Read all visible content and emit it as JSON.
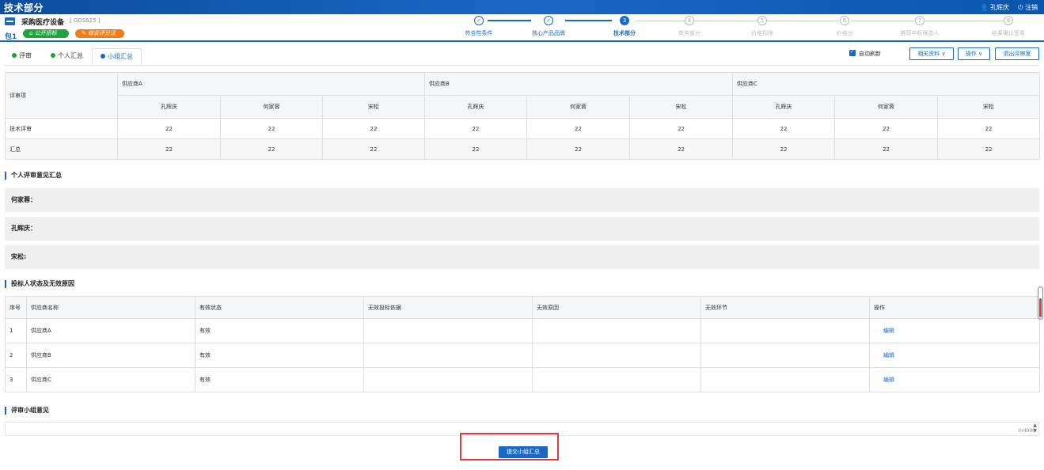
{
  "topbar": {
    "title": "技术部分",
    "user": "孔辉庆",
    "logout": "注销"
  },
  "project": {
    "name": "采购医疗设备",
    "code": "[ GDS525 ]",
    "package": "包1",
    "badge_open": "公开招标",
    "badge_review": "综合评分法"
  },
  "steps": [
    {
      "num": "✓",
      "label": "符合性条件",
      "state": "done"
    },
    {
      "num": "✓",
      "label": "核心产品品牌",
      "state": "done"
    },
    {
      "num": "3",
      "label": "技术部分",
      "state": "cur"
    },
    {
      "num": "4",
      "label": "商务部分",
      "state": "todo"
    },
    {
      "num": "5",
      "label": "价格扣除",
      "state": "todo"
    },
    {
      "num": "6",
      "label": "价格分",
      "state": "todo"
    },
    {
      "num": "7",
      "label": "推荐中标候选人",
      "state": "todo"
    },
    {
      "num": "8",
      "label": "结果确认签章",
      "state": "todo"
    }
  ],
  "tabs": {
    "review": "评审",
    "personal": "个人汇总",
    "group": "小组汇总"
  },
  "toolbar": {
    "auto_refresh": "自动刷新",
    "related": "相关资料 ∨",
    "ops": "操作 ∨",
    "exit": "退出评审室"
  },
  "score_table": {
    "item_header": "评审项",
    "suppliers": [
      "供应商A",
      "供应商B",
      "供应商C"
    ],
    "experts": [
      "孔辉庆",
      "何家蓉",
      "宋松"
    ],
    "rows": [
      {
        "label": "技术评审",
        "values": [
          "22",
          "22",
          "22",
          "22",
          "22",
          "22",
          "22",
          "22",
          "22"
        ]
      },
      {
        "label": "汇总",
        "values": [
          "22",
          "22",
          "22",
          "22",
          "22",
          "22",
          "22",
          "22",
          "22"
        ]
      }
    ]
  },
  "opinions": {
    "section_title": "个人评审意见汇总",
    "items": [
      "何家蓉：",
      "孔辉庆：",
      "宋松:"
    ]
  },
  "status_table": {
    "section_title": "投标人状态及无效原因",
    "headers": [
      "序号",
      "供应商名称",
      "有效状态",
      "无效投标依据",
      "无效原因",
      "无效环节",
      "操作"
    ],
    "rows": [
      {
        "no": "1",
        "name": "供应商A",
        "status": "有效",
        "basis": "",
        "reason": "",
        "stage": "",
        "op": "编辑"
      },
      {
        "no": "2",
        "name": "供应商B",
        "status": "有效",
        "basis": "",
        "reason": "",
        "stage": "",
        "op": "编辑"
      },
      {
        "no": "3",
        "name": "供应商C",
        "status": "有效",
        "basis": "",
        "reason": "",
        "stage": "",
        "op": "编辑"
      }
    ]
  },
  "group_opinion": {
    "section_title": "评审小组意见",
    "counter": "0/4000"
  },
  "submit_label": "提交小组汇总"
}
